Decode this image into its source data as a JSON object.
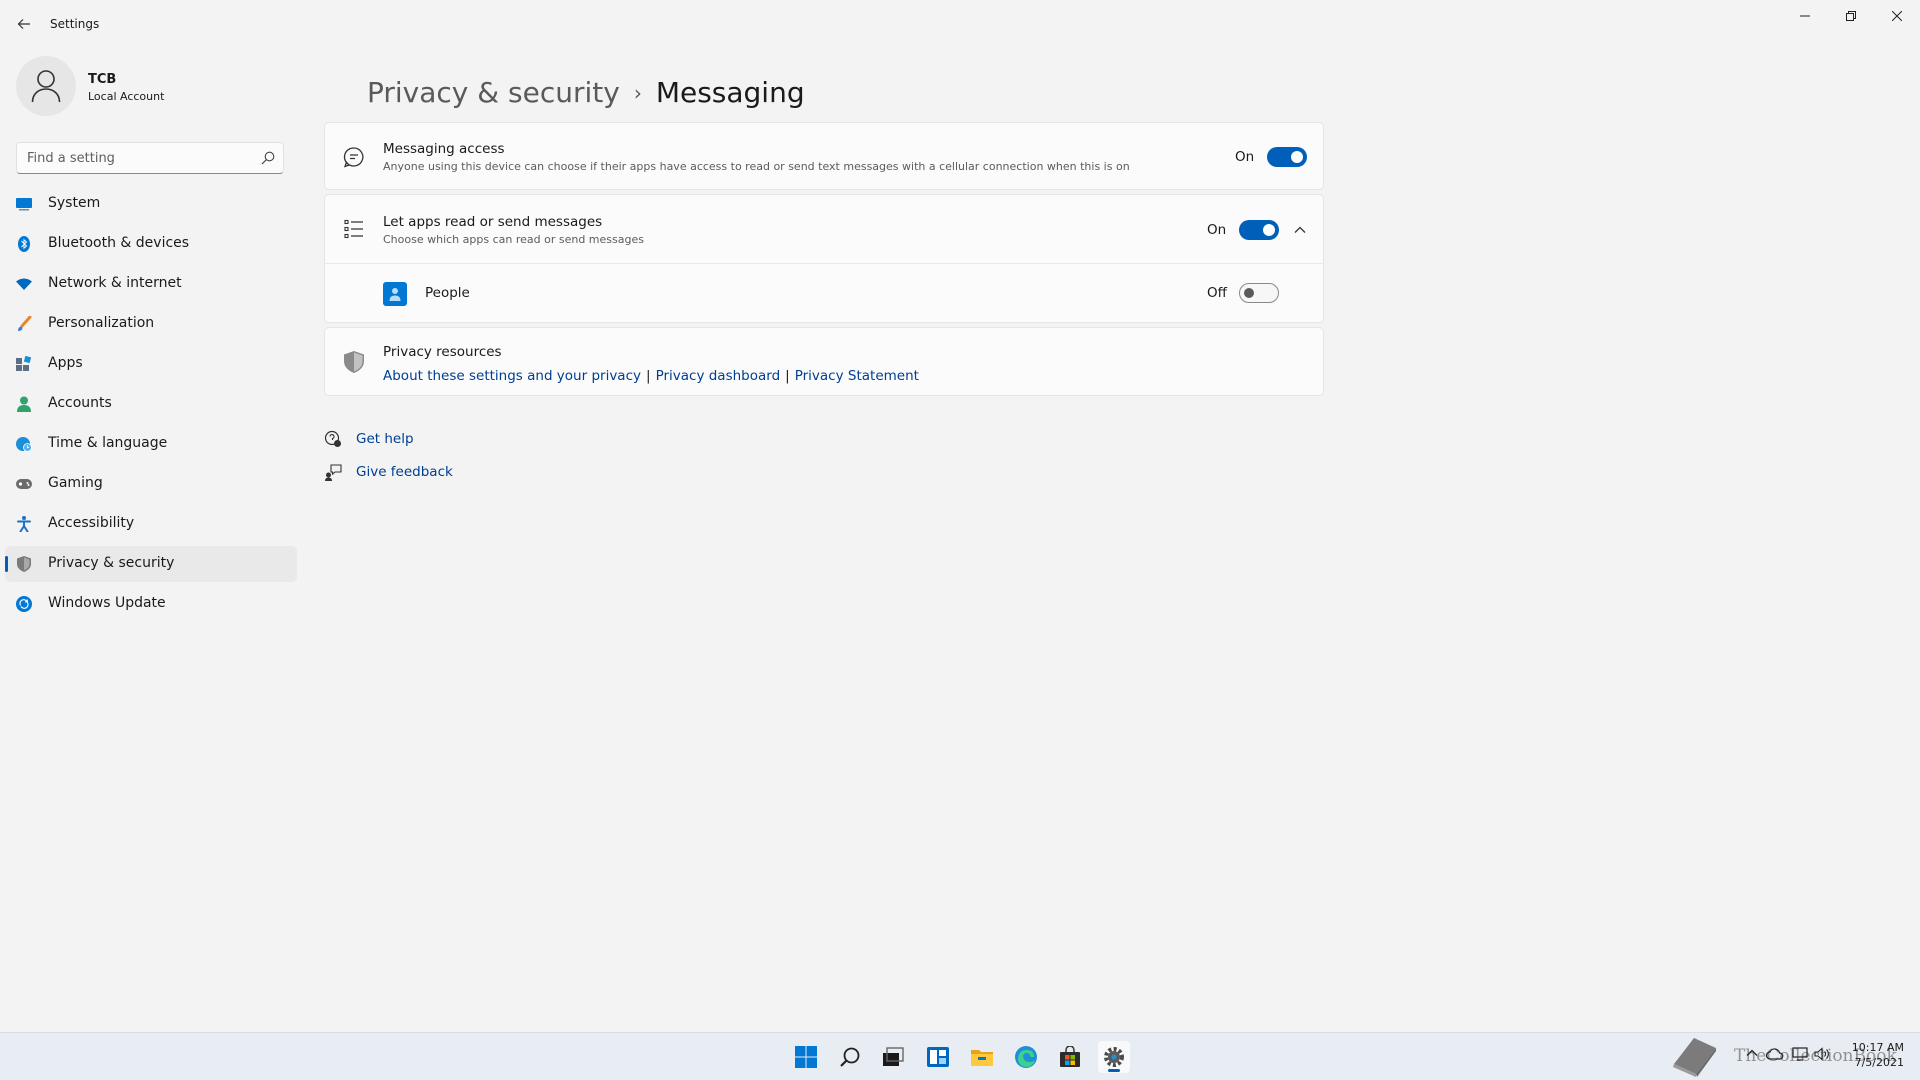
{
  "window": {
    "title": "Settings"
  },
  "account": {
    "name": "TCB",
    "type": "Local Account"
  },
  "search": {
    "placeholder": "Find a setting",
    "value": ""
  },
  "nav": {
    "items": [
      {
        "label": "System",
        "icon": "monitor-icon",
        "color": "#0078d4"
      },
      {
        "label": "Bluetooth & devices",
        "icon": "bluetooth-icon",
        "color": "#0078d4"
      },
      {
        "label": "Network & internet",
        "icon": "wifi-icon",
        "color": "#0067c0"
      },
      {
        "label": "Personalization",
        "icon": "brush-icon",
        "color": "#e8862a"
      },
      {
        "label": "Apps",
        "icon": "apps-icon",
        "color": "#5a6f86"
      },
      {
        "label": "Accounts",
        "icon": "person-icon",
        "color": "#2fa36b"
      },
      {
        "label": "Time & language",
        "icon": "globe-clock-icon",
        "color": "#1a8fd8"
      },
      {
        "label": "Gaming",
        "icon": "gamepad-icon",
        "color": "#6b6b6b"
      },
      {
        "label": "Accessibility",
        "icon": "accessibility-icon",
        "color": "#1a73c8"
      },
      {
        "label": "Privacy & security",
        "icon": "shield-icon",
        "color": "#6b6b6b",
        "active": true
      },
      {
        "label": "Windows Update",
        "icon": "update-icon",
        "color": "#0078d4"
      }
    ]
  },
  "breadcrumb": {
    "parent": "Privacy & security",
    "separator": "›",
    "current": "Messaging"
  },
  "messaging_access": {
    "title": "Messaging access",
    "description": "Anyone using this device can choose if their apps have access to read or send text messages with a cellular connection when this is on",
    "state": "On",
    "enabled": true
  },
  "apps_access": {
    "title": "Let apps read or send messages",
    "description": "Choose which apps can read or send messages",
    "state": "On",
    "enabled": true,
    "expanded": true
  },
  "app_list": [
    {
      "name": "People",
      "state": "Off",
      "enabled": false
    }
  ],
  "privacy_resources": {
    "title": "Privacy resources",
    "links": [
      "About these settings and your privacy",
      "Privacy dashboard",
      "Privacy Statement"
    ],
    "separator": "|"
  },
  "help": {
    "get_help": "Get help",
    "give_feedback": "Give feedback"
  },
  "taskbar": {
    "apps": [
      "start-icon",
      "search-icon",
      "task-view-icon",
      "widgets-icon",
      "file-explorer-icon",
      "edge-icon",
      "store-icon",
      "settings-icon"
    ],
    "watermark": "TheCollectionBook",
    "time": "10:17 AM",
    "date": "7/5/2021"
  },
  "colors": {
    "accent": "#005fb8",
    "link": "#003e92",
    "background": "#f3f3f3"
  }
}
